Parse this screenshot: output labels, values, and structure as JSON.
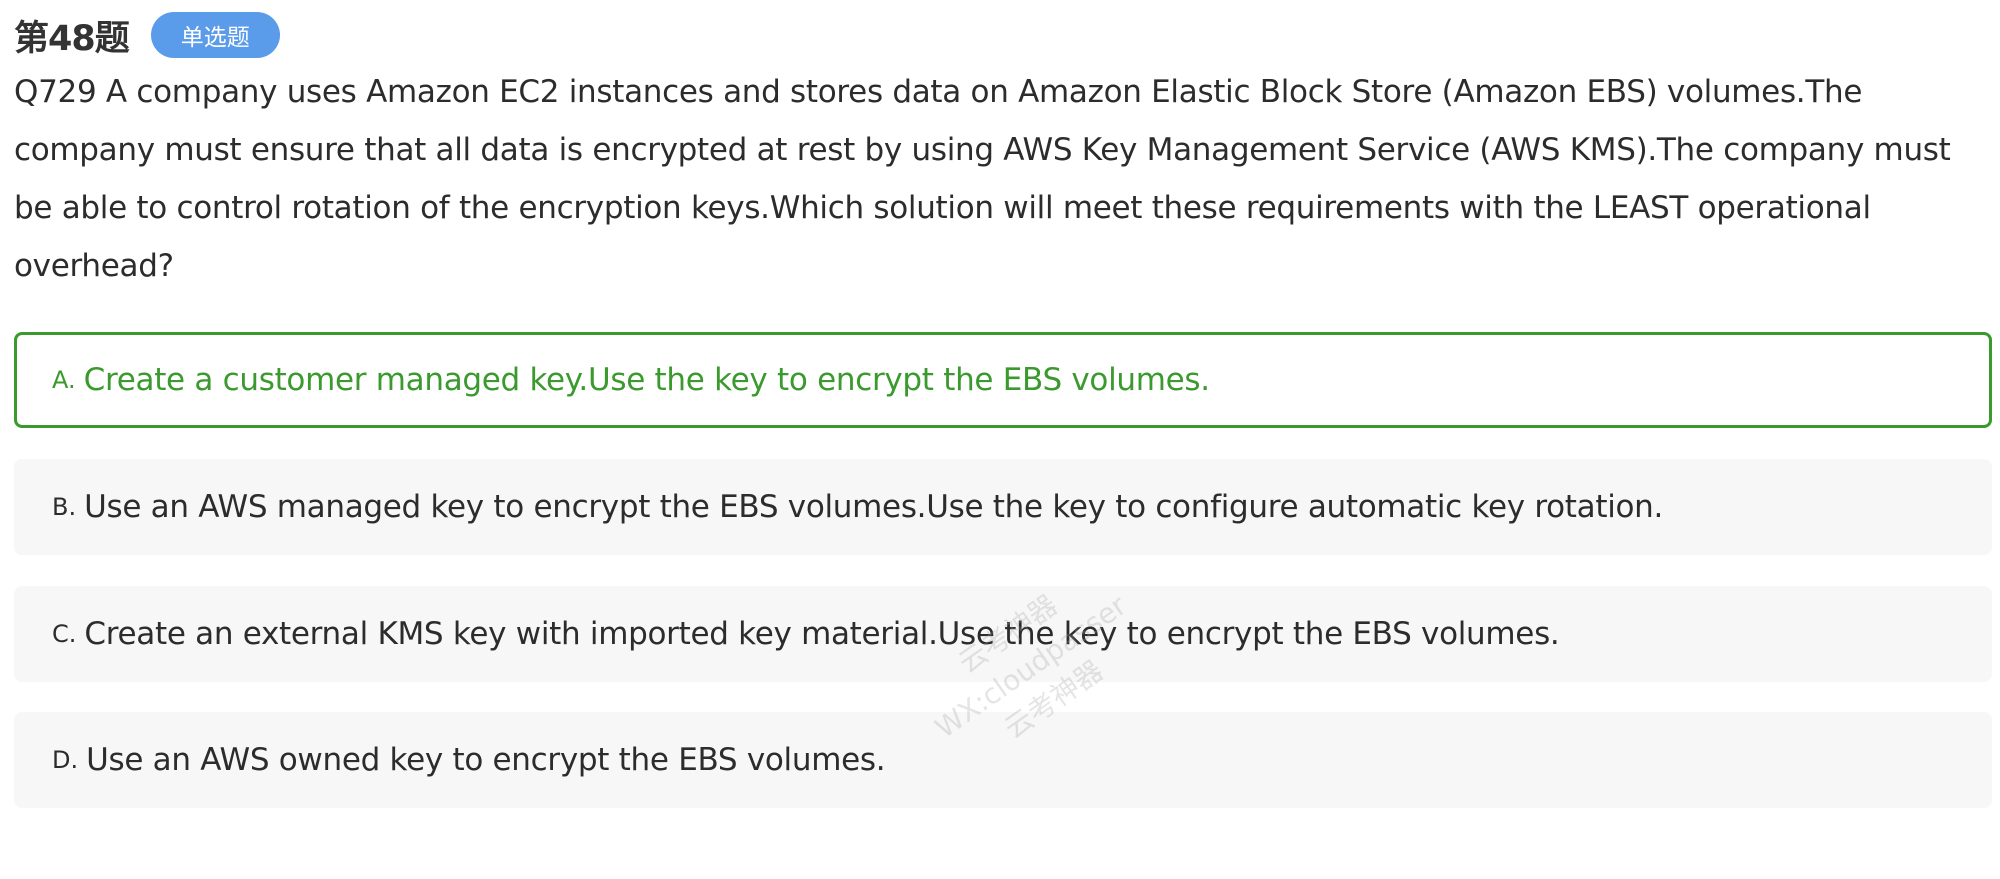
{
  "header": {
    "question_number": "第48题",
    "question_type": "单选题"
  },
  "question": {
    "text": "Q729 A company uses Amazon EC2 instances and stores data on Amazon Elastic Block Store (Amazon EBS) volumes.The company must ensure that all data is encrypted at rest by using AWS Key Management Service (AWS KMS).The company must be able to control rotation of the encryption keys.Which solution will meet these requirements with the LEAST operational overhead?"
  },
  "options": [
    {
      "letter": "A.",
      "text": "Create a customer managed key.Use the key to encrypt the EBS volumes.",
      "selected": true
    },
    {
      "letter": "B.",
      "text": "Use an AWS managed key to encrypt the EBS volumes.Use the key to configure automatic key rotation.",
      "selected": false
    },
    {
      "letter": "C.",
      "text": "Create an external KMS key with imported key material.Use the key to encrypt the EBS volumes.",
      "selected": false
    },
    {
      "letter": "D.",
      "text": "Use an AWS owned key to encrypt the EBS volumes.",
      "selected": false
    }
  ],
  "watermark": {
    "line1": "云考神器",
    "line2": "WX:cloudpasser",
    "line3": "云考神器"
  },
  "colors": {
    "badge": "#5a9bea",
    "selected": "#3b9a2e",
    "option_bg": "#f7f7f7",
    "text": "#2c2c2c"
  }
}
